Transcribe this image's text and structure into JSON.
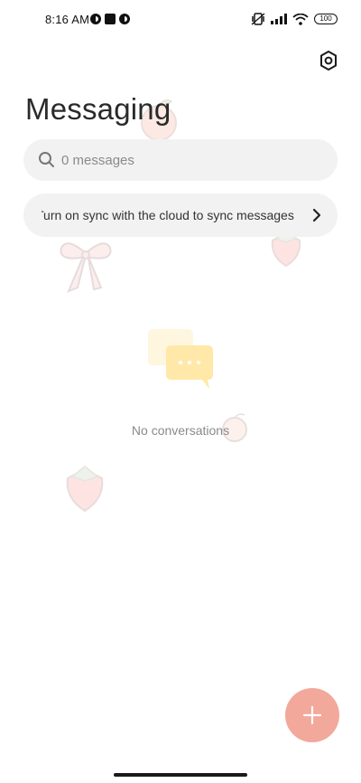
{
  "status_bar": {
    "time": "8:16 AM",
    "battery": "100"
  },
  "header": {
    "title": "Messaging",
    "settings_icon": "gear-icon"
  },
  "search": {
    "placeholder": "0 messages"
  },
  "sync_banner": {
    "text": "Turn on sync with the cloud to sync messages"
  },
  "empty_state": {
    "text": "No conversations"
  },
  "fab": {
    "icon": "plus-icon",
    "color": "#f2a89a"
  },
  "colors": {
    "background": "#ffffff",
    "surface": "#f2f2f2",
    "accent": "#f2a89a"
  }
}
